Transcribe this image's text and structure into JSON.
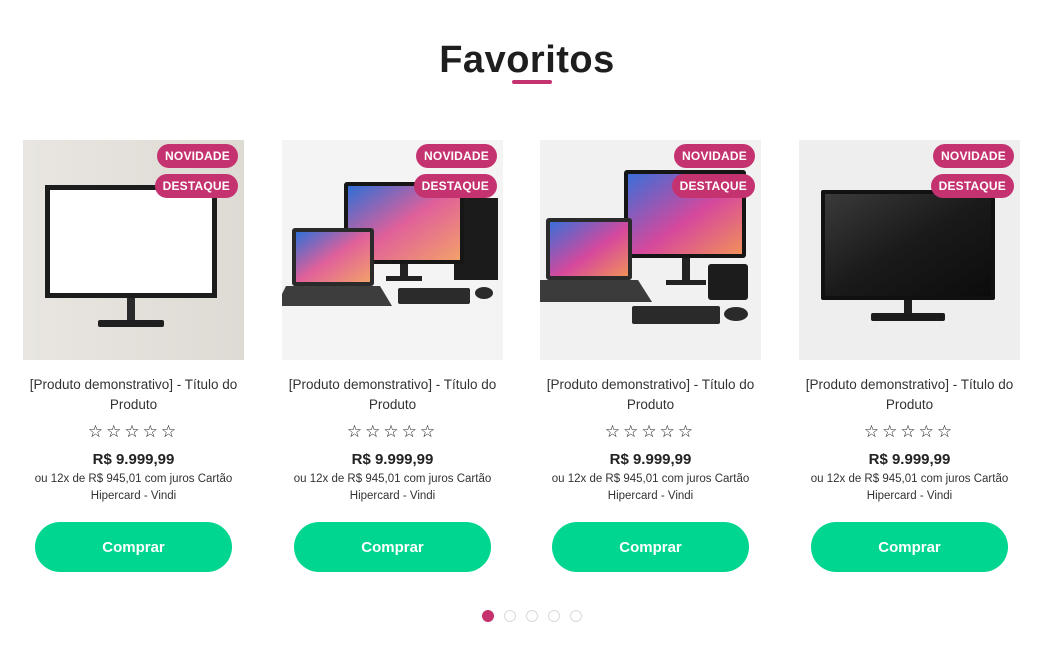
{
  "section": {
    "title": "Favoritos"
  },
  "products": [
    {
      "badges": [
        "NOVIDADE",
        "DESTAQUE"
      ],
      "name": "[Produto demonstrativo] - Título do Produto",
      "rating": "☆☆☆☆☆",
      "price": "R$ 9.999,99",
      "installments": "ou 12x de R$ 945,01 com juros Cartão Hipercard - Vindi",
      "button": "Comprar",
      "image_icon": "monitor-white-screen"
    },
    {
      "badges": [
        "NOVIDADE",
        "DESTAQUE"
      ],
      "name": "[Produto demonstrativo] - Título do Produto",
      "rating": "☆☆☆☆☆",
      "price": "R$ 9.999,99",
      "installments": "ou 12x de R$ 945,01 com juros Cartão Hipercard - Vindi",
      "button": "Comprar",
      "image_icon": "desktop-laptop-set"
    },
    {
      "badges": [
        "NOVIDADE",
        "DESTAQUE"
      ],
      "name": "[Produto demonstrativo] - Título do Produto",
      "rating": "☆☆☆☆☆",
      "price": "R$ 9.999,99",
      "installments": "ou 12x de R$ 945,01 com juros Cartão Hipercard - Vindi",
      "button": "Comprar",
      "image_icon": "desktop-laptop-set"
    },
    {
      "badges": [
        "NOVIDADE",
        "DESTAQUE"
      ],
      "name": "[Produto demonstrativo] - Título do Produto",
      "rating": "☆☆☆☆☆",
      "price": "R$ 9.999,99",
      "installments": "ou 12x de R$ 945,01 com juros Cartão Hipercard - Vindi",
      "button": "Comprar",
      "image_icon": "monitor-black-screen"
    }
  ],
  "pagination": {
    "pages": 5,
    "active": 1
  },
  "colors": {
    "accent": "#c4336f",
    "button": "#00d690"
  }
}
